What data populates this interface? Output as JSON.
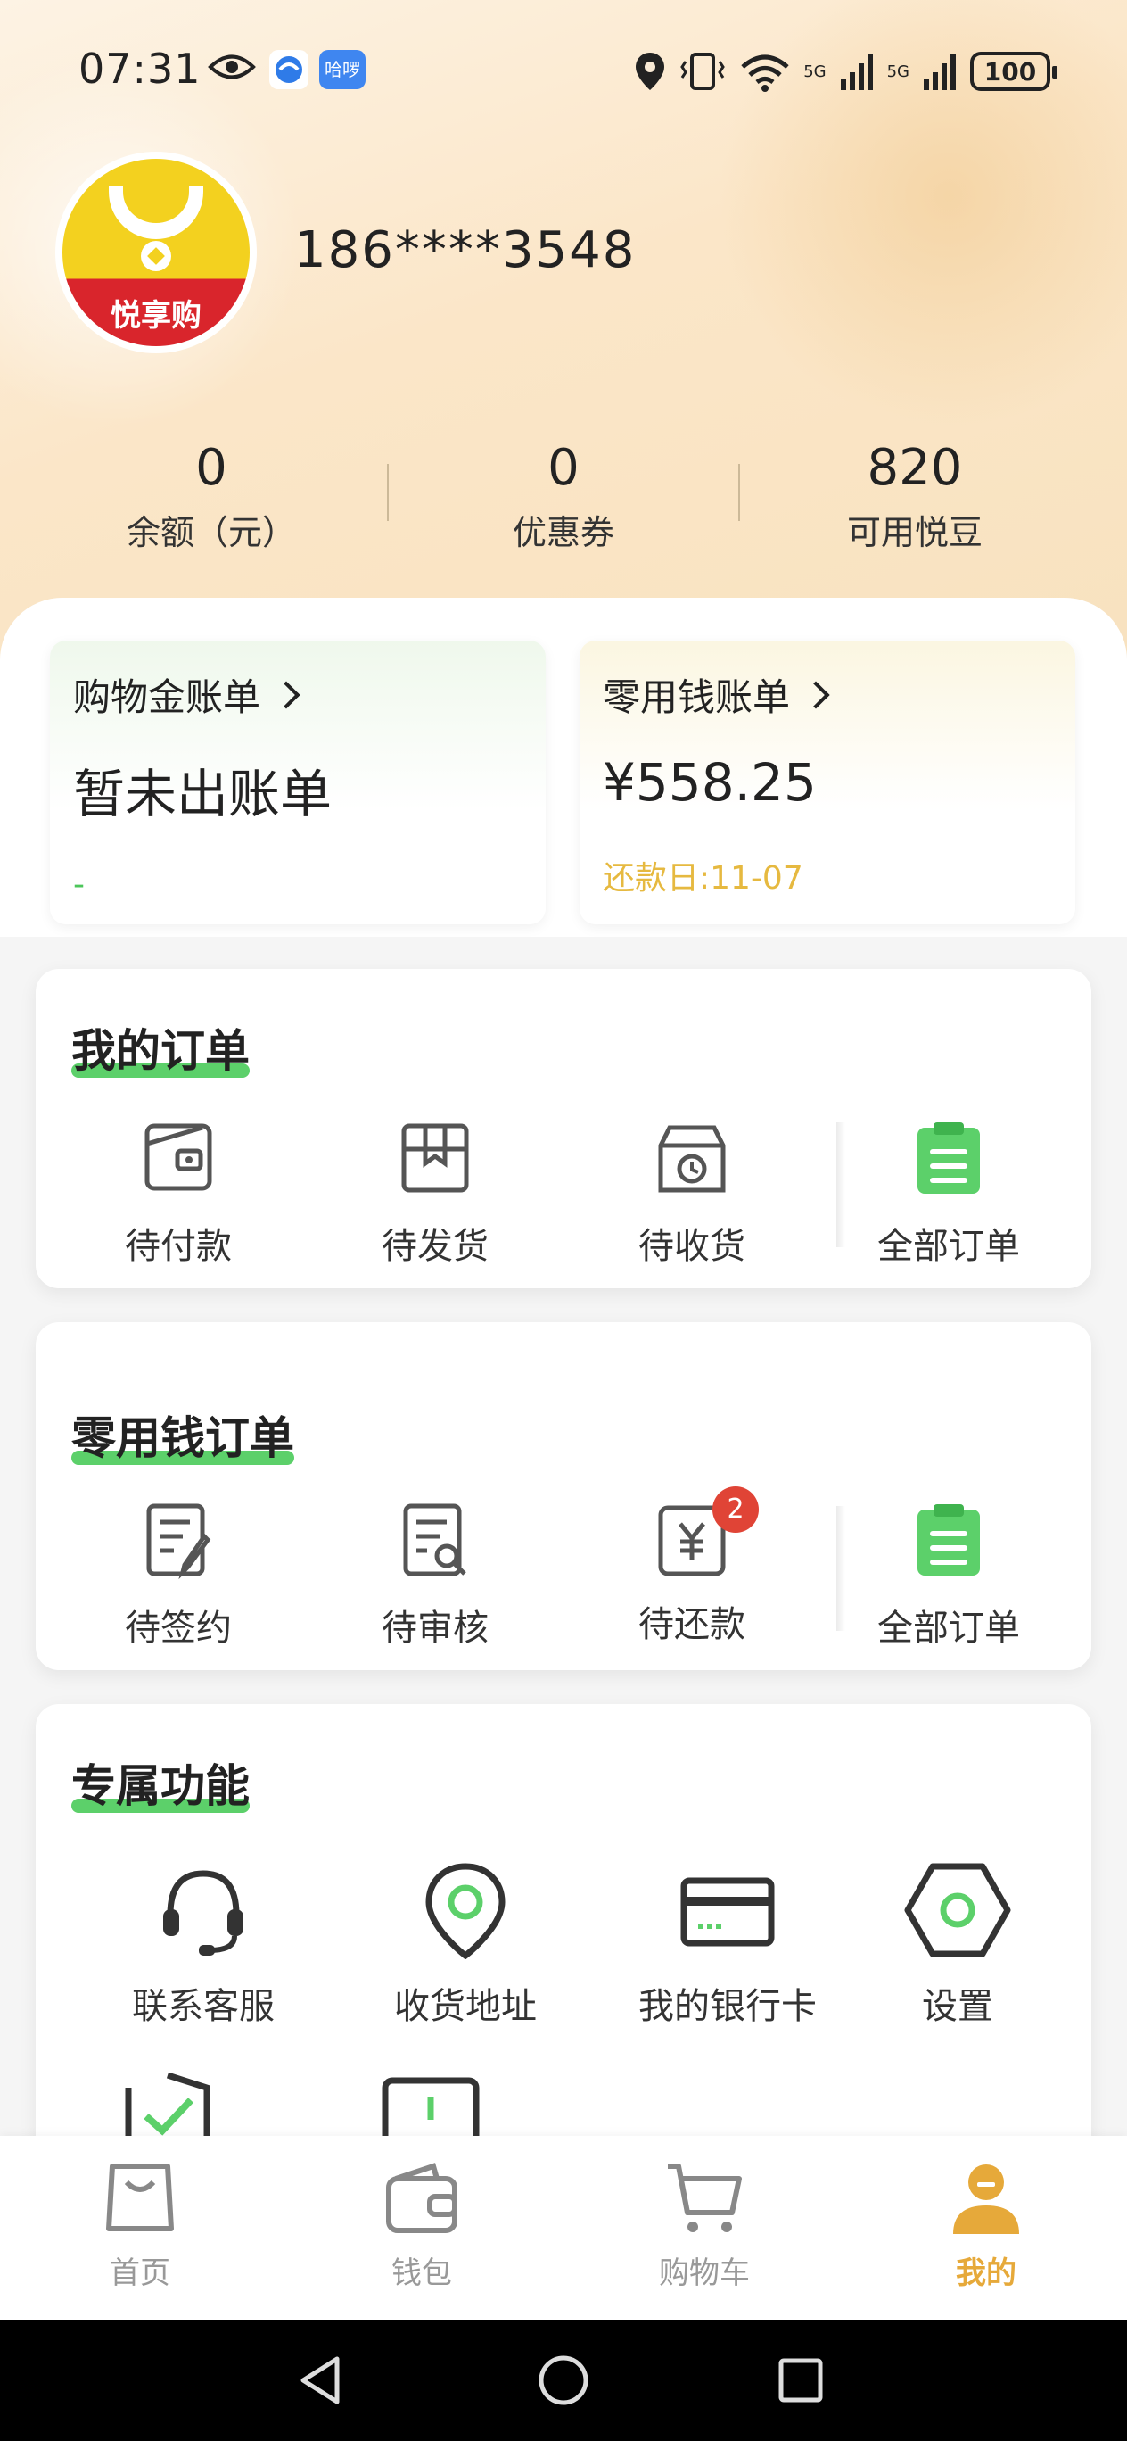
{
  "status_bar": {
    "time": "07:31",
    "app_badge": "哈啰",
    "net1": "5G",
    "net2": "5G",
    "battery": "100",
    "icons": [
      "eye-icon",
      "location-icon",
      "vibrate-icon",
      "wifi-icon",
      "signal-icon"
    ]
  },
  "profile": {
    "avatar_brand": "悦享购",
    "phone": "186****3548"
  },
  "stats": [
    {
      "value": "0",
      "label": "余额（元）"
    },
    {
      "value": "0",
      "label": "优惠券"
    },
    {
      "value": "820",
      "label": "可用悦豆"
    }
  ],
  "bills": {
    "shopping": {
      "title": "购物金账单",
      "main": "暂未出账单",
      "sub": "-"
    },
    "pocket": {
      "title": "零用钱账单",
      "main": "¥558.25",
      "sub": "还款日:11-07"
    }
  },
  "my_orders": {
    "title": "我的订单",
    "items": [
      {
        "label": "待付款",
        "icon": "wallet-icon"
      },
      {
        "label": "待发货",
        "icon": "box-icon"
      },
      {
        "label": "待收货",
        "icon": "delivery-icon"
      },
      {
        "label": "全部订单",
        "icon": "clipboard-icon"
      }
    ]
  },
  "pocket_orders": {
    "title": "零用钱订单",
    "items": [
      {
        "label": "待签约",
        "icon": "sign-document-icon"
      },
      {
        "label": "待审核",
        "icon": "review-document-icon"
      },
      {
        "label": "待还款",
        "icon": "repay-icon",
        "badge": "2"
      },
      {
        "label": "全部订单",
        "icon": "clipboard-icon"
      }
    ]
  },
  "features": {
    "title": "专属功能",
    "items": [
      {
        "label": "联系客服",
        "icon": "headset-icon"
      },
      {
        "label": "收货地址",
        "icon": "location-pin-icon"
      },
      {
        "label": "我的银行卡",
        "icon": "bank-card-icon"
      },
      {
        "label": "设置",
        "icon": "settings-hexagon-icon"
      }
    ]
  },
  "tabbar": [
    {
      "label": "首页",
      "icon": "shopping-bag-icon"
    },
    {
      "label": "钱包",
      "icon": "wallet-tab-icon"
    },
    {
      "label": "购物车",
      "icon": "cart-icon"
    },
    {
      "label": "我的",
      "icon": "profile-icon",
      "active": true
    }
  ],
  "colors": {
    "accent_green": "#5cd06a",
    "accent_gold": "#e6a93a",
    "badge_red": "#e04436"
  }
}
